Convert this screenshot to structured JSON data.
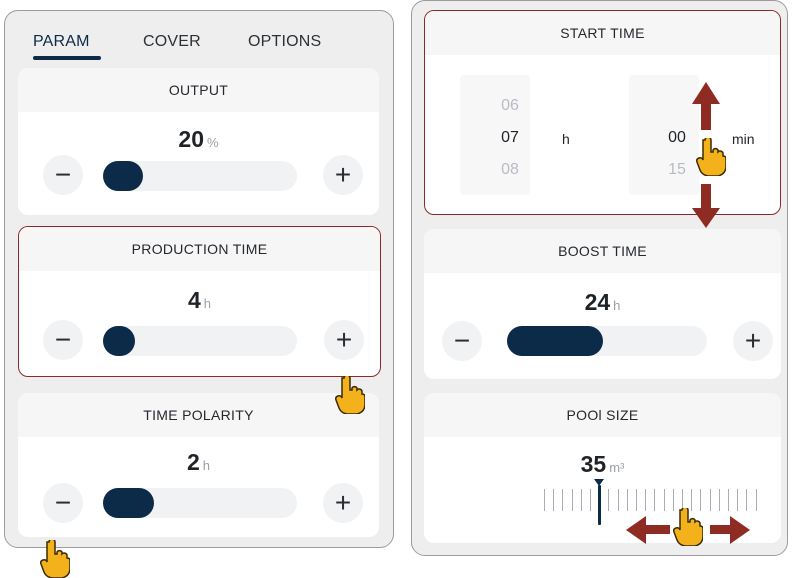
{
  "tabs": [
    {
      "label": "PARAM",
      "active": true
    },
    {
      "label": "COVER",
      "active": false
    },
    {
      "label": "OPTIONS",
      "active": false
    }
  ],
  "output": {
    "title": "OUTPUT",
    "value": "20",
    "unit": "%",
    "level_fraction": 0.15
  },
  "production_time": {
    "title": "PRODUCTION TIME",
    "value": "4",
    "unit": "h",
    "level_fraction": 0.12
  },
  "time_polarity": {
    "title": "TIME POLARITY",
    "value": "2",
    "unit": "h",
    "level_fraction": 0.25
  },
  "start_time": {
    "title": "START TIME",
    "hours": {
      "prev": "06",
      "current": "07",
      "next": "08",
      "unit": "h"
    },
    "minutes": {
      "prev": "",
      "current": "00",
      "next": "15",
      "unit": "min"
    }
  },
  "boost_time": {
    "title": "BOOST TIME",
    "value": "24",
    "unit": "h",
    "level_fraction": 0.45
  },
  "pool_size": {
    "title": "POOl SIZE",
    "value": "35",
    "unit": "m³"
  },
  "controls": {
    "minus": "−",
    "plus": "+"
  },
  "colors": {
    "accent": "#0c2b49",
    "highlight": "#8c2a2a",
    "arrow": "#8e2b22",
    "hand": "#f3b21b"
  }
}
